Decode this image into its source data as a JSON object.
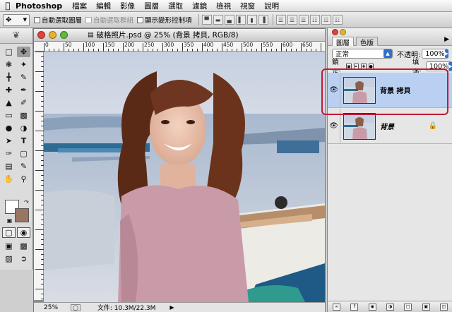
{
  "menubar": {
    "apple": "",
    "app_name": "Photoshop",
    "items": [
      "檔案",
      "編輯",
      "影像",
      "圖層",
      "選取",
      "濾鏡",
      "檢視",
      "視窗",
      "說明"
    ]
  },
  "options": {
    "auto_select_layer": "自動選取圖層",
    "auto_select_group": "自動選取群組",
    "show_transform": "顯示變形控制項"
  },
  "document": {
    "title": "破格照片.psd @ 25% (背景 拷貝, RGB/8)",
    "zoom": "25%",
    "file_info": "文件: 10.3M/22.3M",
    "hruler_labels": [
      "0",
      "50",
      "100",
      "150",
      "200",
      "250",
      "300",
      "350",
      "400",
      "450",
      "500",
      "550",
      "600",
      "650"
    ]
  },
  "layers_panel": {
    "tabs": [
      "圖層",
      "色版"
    ],
    "blend_mode": "正常",
    "opacity_label": "不透明:",
    "opacity_value": "100%",
    "lock_label": "鎖定:",
    "fill_label": "填滿:",
    "fill_value": "100%",
    "layers": [
      {
        "name": "背景 拷貝",
        "selected": true,
        "locked": false
      },
      {
        "name": "背景",
        "selected": false,
        "locked": true
      }
    ]
  },
  "colors": {
    "foreground": "#ffffff",
    "background": "#9a7564",
    "selected_layer": "#b9d0f2",
    "highlight": "#c11b38"
  }
}
